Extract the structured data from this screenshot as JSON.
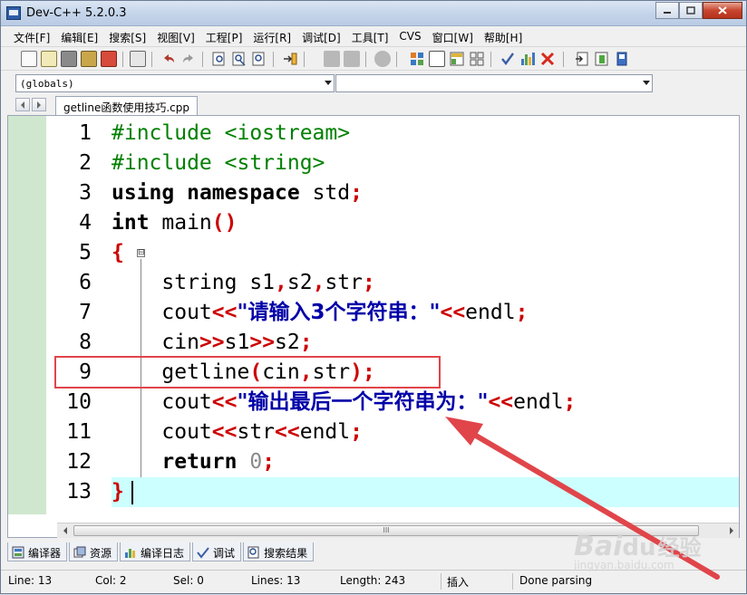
{
  "window": {
    "title": "Dev-C++ 5.2.0.3"
  },
  "menu": [
    "文件[F]",
    "编辑[E]",
    "搜索[S]",
    "视图[V]",
    "工程[P]",
    "运行[R]",
    "调试[D]",
    "工具[T]",
    "CVS",
    "窗口[W]",
    "帮助[H]"
  ],
  "combos": {
    "scope": "(globals)",
    "member": ""
  },
  "tab": {
    "filename": "getline函数使用技巧.cpp"
  },
  "editor": {
    "line_numbers": [
      "1",
      "2",
      "3",
      "4",
      "5",
      "6",
      "7",
      "8",
      "9",
      "10",
      "11",
      "12",
      "13"
    ],
    "code": {
      "l1_pp": "#include <iostream>",
      "l2_pp": "#include <string>",
      "l3_kw1": "using",
      "l3_kw2": "namespace",
      "l3_rest": " std",
      "l3_semi": ";",
      "l4_kw": "int",
      "l4_rest": " main",
      "l4_paren": "()",
      "l5_brace": "{",
      "l6_a": "    string s1",
      "l6_c1": ",",
      "l6_b": "s2",
      "l6_c2": ",",
      "l6_c": "str",
      "l6_semi": ";",
      "l7_a": "    cout",
      "l7_op1": "<<",
      "l7_str": "\"请输入3个字符串：\"",
      "l7_op2": "<<",
      "l7_b": "endl",
      "l7_semi": ";",
      "l8_a": "    cin",
      "l8_op1": ">>",
      "l8_b": "s1",
      "l8_op2": ">>",
      "l8_c": "s2",
      "l8_semi": ";",
      "l9_a": "    getline",
      "l9_p1": "(",
      "l9_b": "cin",
      "l9_comma": ",",
      "l9_c": "str",
      "l9_p2": ");",
      "l10_a": "    cout",
      "l10_op1": "<<",
      "l10_str": "\"输出最后一个字符串为：\"",
      "l10_op2": "<<",
      "l10_b": "endl",
      "l10_semi": ";",
      "l11_a": "    cout",
      "l11_op1": "<<",
      "l11_b": "str",
      "l11_op2": "<<",
      "l11_c": "endl",
      "l11_semi": ";",
      "l12_kw": "    return",
      "l12_num": " 0",
      "l12_semi": ";",
      "l13_brace": "}"
    },
    "fold_toggle": "⊟",
    "hscroll_grip": "III"
  },
  "bottom_tabs": [
    "编译器",
    "资源",
    "编译日志",
    "调试",
    "搜索结果"
  ],
  "status": {
    "line": "Line:   13",
    "col": "Col:    2",
    "sel": "Sel:    0",
    "lines": "Lines:   13",
    "length": "Length:  243",
    "mode": "插入",
    "parse": "Done parsing"
  },
  "watermark": {
    "brand": "Bai",
    "paw": "du",
    "cn": "经验",
    "url": "jingyan.baidu.com"
  },
  "colors": {
    "highlight_box": "#e0454a",
    "arrow": "#e0454a",
    "active_line": "#ccffff",
    "gutter": "#cfe7cf"
  }
}
